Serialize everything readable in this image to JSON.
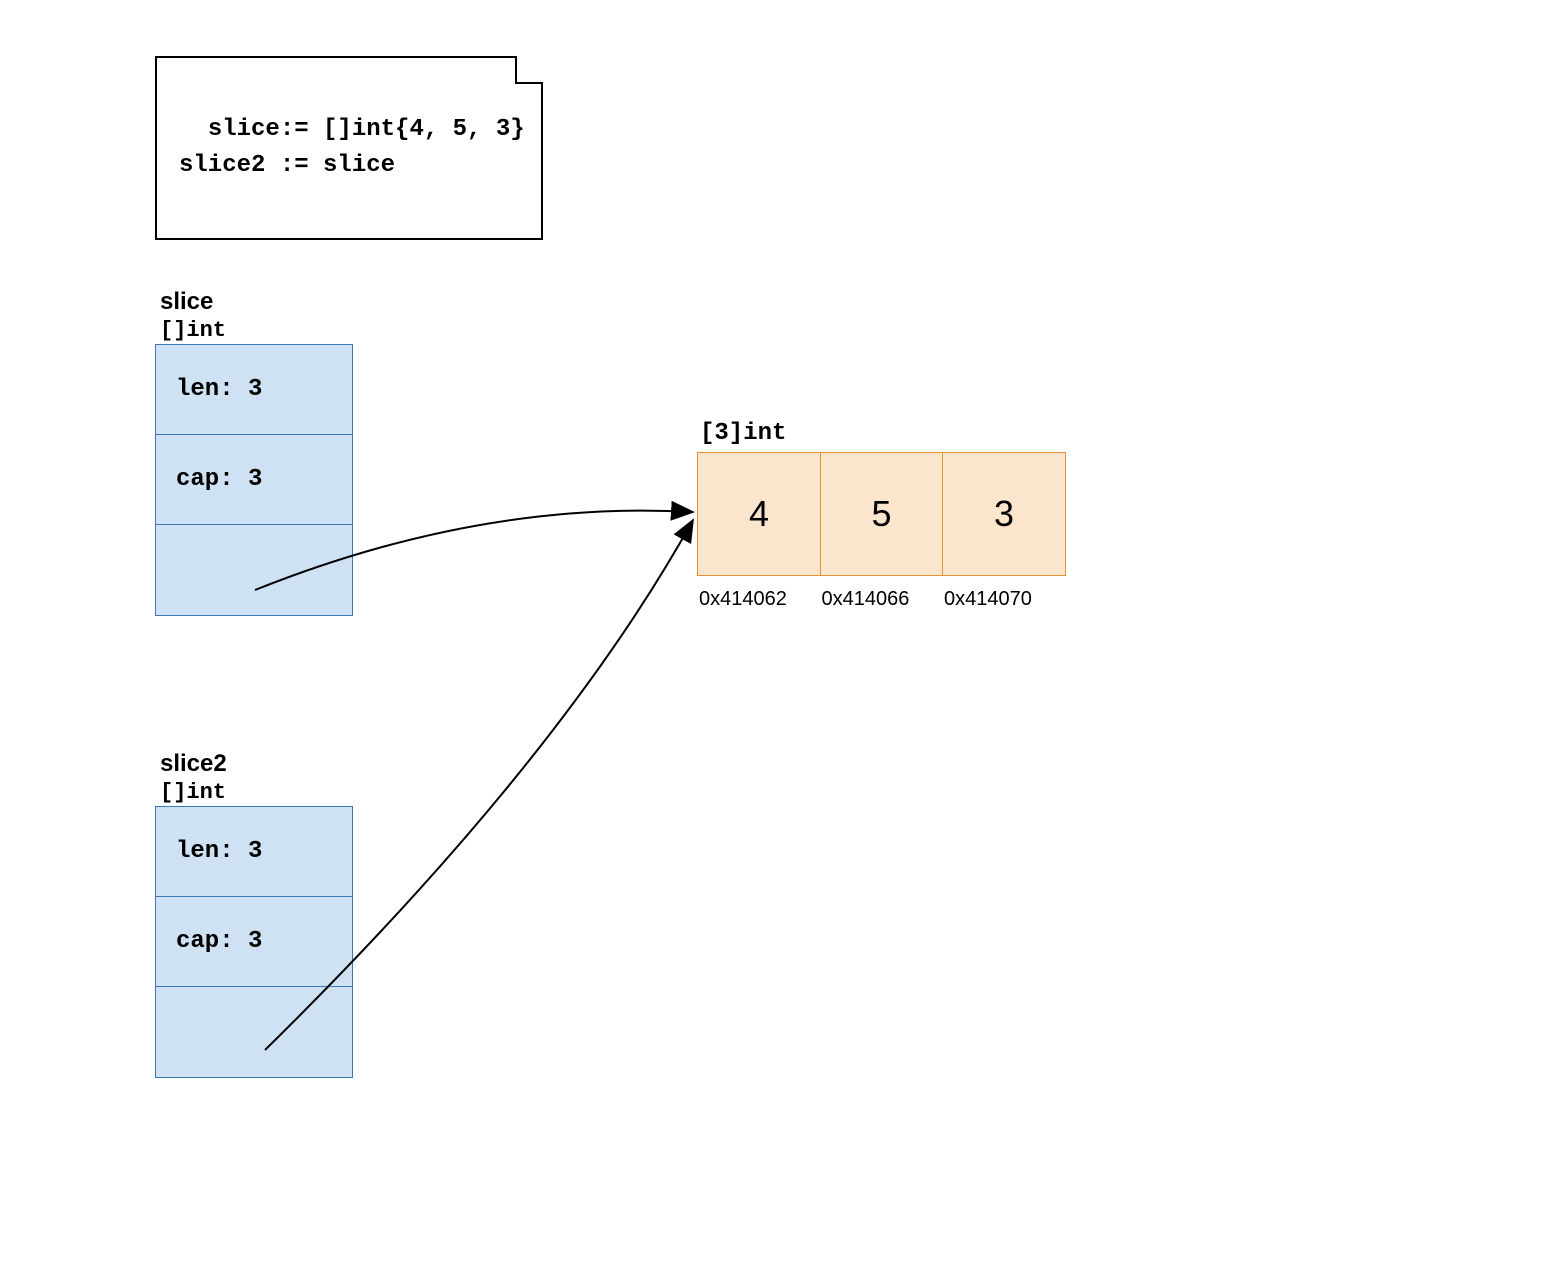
{
  "code": {
    "line1": "slice:= []int{4, 5, 3}",
    "line2": "slice2 := slice"
  },
  "slice1": {
    "name": "slice",
    "type": "[]int",
    "len": "len: 3",
    "cap": "cap: 3"
  },
  "slice2": {
    "name": "slice2",
    "type": "[]int",
    "len": "len: 3",
    "cap": "cap: 3"
  },
  "array": {
    "type": "[3]int",
    "values": [
      "4",
      "5",
      "3"
    ],
    "addresses": [
      "0x414062",
      "0x414066",
      "0x414070"
    ]
  }
}
